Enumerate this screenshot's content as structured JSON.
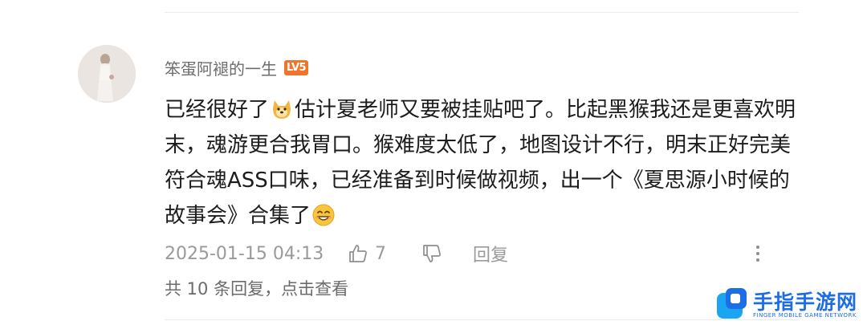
{
  "comment": {
    "username": "笨蛋阿褪的一生",
    "level_badge": "LV5",
    "body_part1": "已经很好了",
    "body_part2": "估计夏老师又要被挂贴吧了。比起黑猴我还是更喜欢明末，魂游更合我胃口。猴难度太低了，地图设计不行，明末正好完美符合魂ASS口味，已经准备到时候做视频，出一个《夏思源小时候的故事会》合集了",
    "emoji_1": "doge-icon",
    "emoji_2": "smile-icon",
    "timestamp": "2025-01-15 04:13",
    "like_count": "7",
    "reply_label": "回复",
    "replies_summary": "共 10 条回复，点击查看"
  },
  "watermark": {
    "title": "手指手游网",
    "subtitle": "FINGER MOBILE GAME NETWORK"
  },
  "colors": {
    "level_badge": "#f0742a",
    "watermark_blue": "#1d6de5",
    "meta_text": "#9a9a9a"
  }
}
